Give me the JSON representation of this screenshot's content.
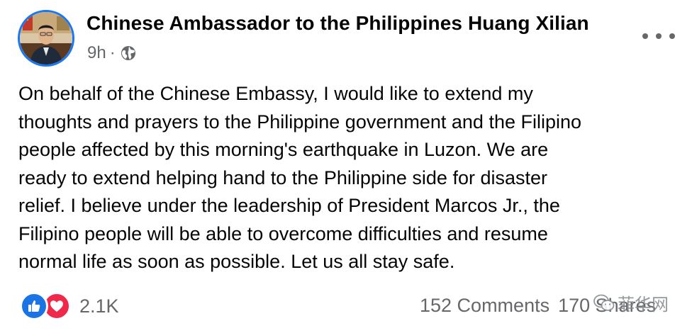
{
  "post": {
    "author": "Chinese Ambassador to the Philippines Huang Xilian",
    "time": "9h",
    "separator": "·",
    "visibility_icon": "globe-icon",
    "more_icon": "more-options-icon",
    "paragraph_lines": [
      "On behalf of the Chinese Embassy, I would like to extend my",
      "thoughts and prayers to the Philippine government and the Filipino",
      "people affected by this morning's earthquake in Luzon. We are",
      "ready to extend helping hand to the Philippine side for disaster",
      "relief. I believe under the leadership of President Marcos Jr., the",
      "Filipino people will be able to overcome difficulties and resume",
      "normal life as soon as possible. Let us all stay safe."
    ],
    "reactions": {
      "icons": [
        "like-icon",
        "love-icon"
      ],
      "count": "2.1K"
    },
    "comments": "152 Comments",
    "shares": "170 Shares"
  },
  "watermark": {
    "text": "菲华网",
    "icon": "wechat-icon"
  },
  "colors": {
    "accent": "#1877f2",
    "like": "#1b74e4",
    "love": "#f0284a",
    "secondary_text": "#65676b"
  }
}
